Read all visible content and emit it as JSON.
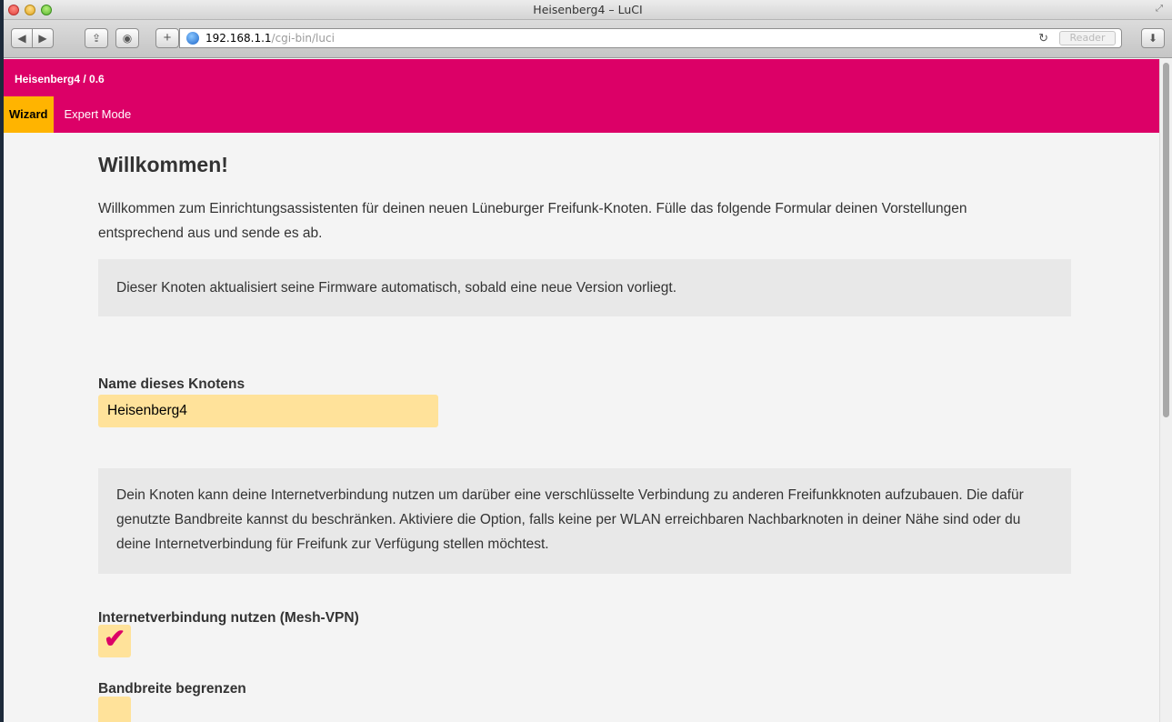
{
  "window": {
    "title": "Heisenberg4 – LuCI"
  },
  "toolbar": {
    "url_host": "192.168.1.1",
    "url_path": "/cgi-bin/luci",
    "reader_label": "Reader"
  },
  "header": {
    "brand": "Heisenberg4 / 0.6",
    "nav": [
      {
        "label": "Wizard",
        "active": true
      },
      {
        "label": "Expert Mode",
        "active": false
      }
    ]
  },
  "main": {
    "heading": "Willkommen!",
    "intro": "Willkommen zum Einrichtungsassistenten für deinen neuen Lüneburger Freifunk-Knoten. Fülle das folgende Formular deinen Vorstellungen entsprechend aus und sende es ab.",
    "notice_autoupdate": "Dieser Knoten aktualisiert seine Firmware automatisch, sobald eine neue Version vorliegt.",
    "hostname_label": "Name dieses Knotens",
    "hostname_value": "Heisenberg4",
    "notice_vpn": "Dein Knoten kann deine Internetverbindung nutzen um darüber eine verschlüsselte Verbindung zu anderen Freifunkknoten aufzubauen. Die dafür genutzte Bandbreite kannst du beschränken. Aktiviere die Option, falls keine per WLAN erreichbaren Nachbarknoten in deiner Nähe sind oder du deine Internetverbindung für Freifunk zur Verfügung stellen möchtest.",
    "vpn_label": "Internetverbindung nutzen (Mesh-VPN)",
    "vpn_checked": true,
    "bandwidth_label": "Bandbreite begrenzen",
    "bandwidth_checked": false
  },
  "colors": {
    "accent": "#dc0067",
    "nav_active": "#ffb400",
    "input_bg": "#ffe29a"
  }
}
